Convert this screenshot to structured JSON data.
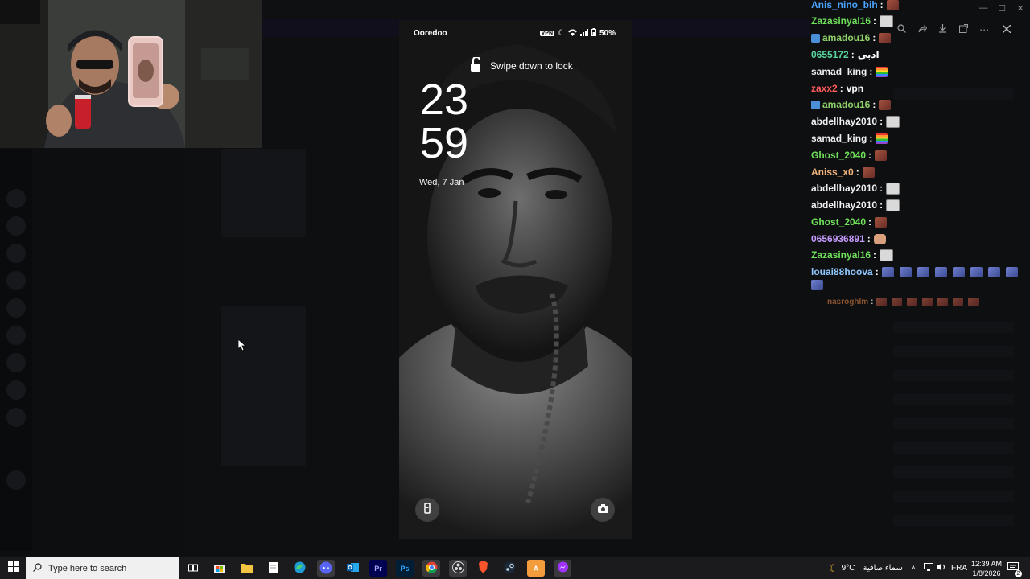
{
  "phone": {
    "carrier": "Ooredoo",
    "vpn_badge": "VPN",
    "battery": "50%",
    "lock_hint": "Swipe down to lock",
    "clock_hours": "23",
    "clock_minutes": "59",
    "date": "Wed, 7 Jan"
  },
  "chat": [
    {
      "name": "Anis_nino_bih",
      "color": "#4aa3ff",
      "text": "",
      "emotes": [
        "red"
      ],
      "badge": false
    },
    {
      "name": "Zazasinyal16",
      "color": "#6fe05a",
      "text": "",
      "emotes": [
        "skull"
      ],
      "badge": false
    },
    {
      "name": "amadou16",
      "color": "#8fd16a",
      "text": "",
      "emotes": [
        "red"
      ],
      "badge": true
    },
    {
      "name": "0655172",
      "color": "#5ad6a0",
      "text": "ادبي",
      "emotes": [],
      "badge": false
    },
    {
      "name": "samad_king",
      "color": "#f0f0f0",
      "text": "",
      "emotes": [
        "pride"
      ],
      "badge": false
    },
    {
      "name": "zaxx2",
      "color": "#ff5c5c",
      "text": "vpn",
      "emotes": [],
      "badge": false
    },
    {
      "name": "amadou16",
      "color": "#8fd16a",
      "text": "",
      "emotes": [
        "red"
      ],
      "badge": true
    },
    {
      "name": "abdellhay2010",
      "color": "#f0f0f0",
      "text": "",
      "emotes": [
        "skull"
      ],
      "badge": false
    },
    {
      "name": "samad_king",
      "color": "#f0f0f0",
      "text": "",
      "emotes": [
        "pride"
      ],
      "badge": false
    },
    {
      "name": "Ghost_2040",
      "color": "#6fe05a",
      "text": "",
      "emotes": [
        "red"
      ],
      "badge": false
    },
    {
      "name": "Aniss_x0",
      "color": "#f2b37a",
      "text": "",
      "emotes": [
        "red"
      ],
      "badge": false
    },
    {
      "name": "abdellhay2010",
      "color": "#f0f0f0",
      "text": "",
      "emotes": [
        "skull"
      ],
      "badge": false
    },
    {
      "name": "abdellhay2010",
      "color": "#f0f0f0",
      "text": "",
      "emotes": [
        "skull"
      ],
      "badge": false
    },
    {
      "name": "Ghost_2040",
      "color": "#6fe05a",
      "text": "",
      "emotes": [
        "red"
      ],
      "badge": false
    },
    {
      "name": "0656936891",
      "color": "#c79cff",
      "text": "",
      "emotes": [
        "hand"
      ],
      "badge": false
    },
    {
      "name": "Zazasinyal16",
      "color": "#6fe05a",
      "text": "",
      "emotes": [
        "skull"
      ],
      "badge": false
    },
    {
      "name": "louai88hoova",
      "color": "#8fc8ff",
      "text": "",
      "emotes": [
        "blue",
        "blue",
        "blue",
        "blue",
        "blue",
        "blue",
        "blue",
        "blue"
      ],
      "badge": false
    }
  ],
  "chat_last": {
    "name": "nasroghlm",
    "color": "#b46a3c",
    "emotes": [
      "red",
      "red",
      "red",
      "red",
      "red",
      "red",
      "red"
    ]
  },
  "viewer_toolbar": {
    "icons": [
      "zoom-icon",
      "share-icon",
      "download-icon",
      "open-external-icon",
      "more-icon",
      "close-icon"
    ]
  },
  "taskbar": {
    "search_placeholder": "Type here to search",
    "weather_temp": "9°C",
    "weather_desc": "سماء صافية",
    "language": "FRA",
    "time": "12:39 AM",
    "date": "1/8/2026",
    "notification_count": "2",
    "apps": [
      "task-view",
      "store",
      "file-explorer",
      "notepad",
      "edge",
      "discord",
      "outlook",
      "premiere",
      "photoshop",
      "chrome",
      "obs",
      "brave",
      "steam",
      "app-a",
      "messenger"
    ]
  },
  "colors": {
    "accent_discord": "#5865f2",
    "taskbar": "#1b1b1d"
  }
}
